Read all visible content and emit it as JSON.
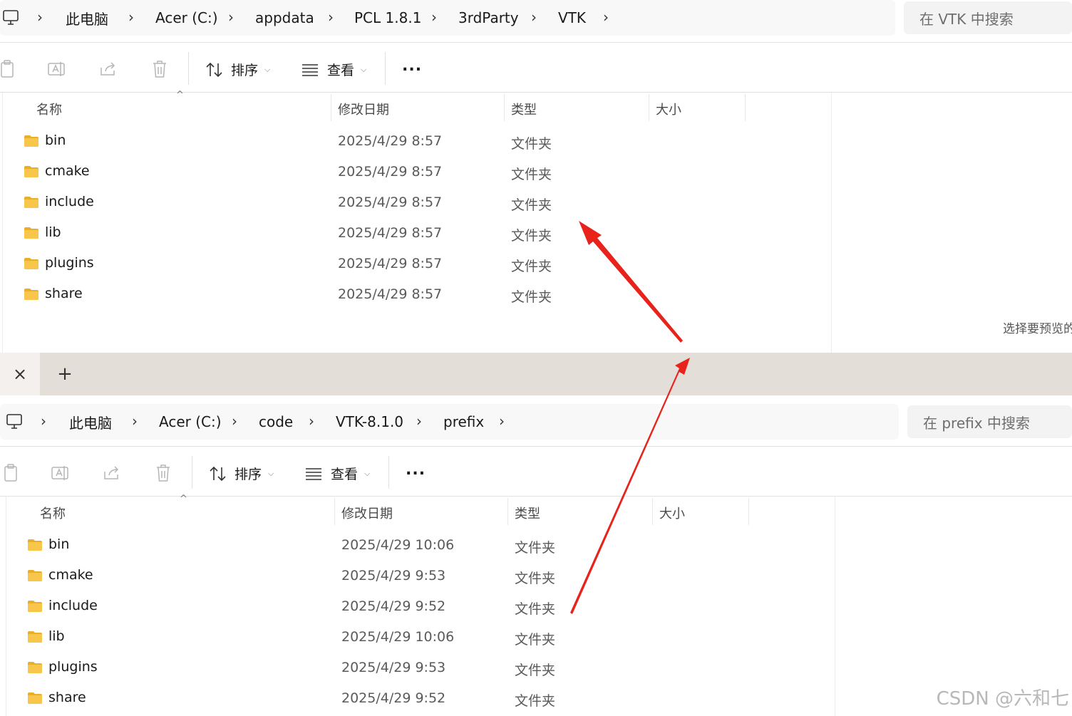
{
  "window1": {
    "breadcrumb": [
      "此电脑",
      "Acer (C:)",
      "appdata",
      "PCL 1.8.1",
      "3rdParty",
      "VTK"
    ],
    "search_placeholder": "在 VTK 中搜索",
    "toolbar": {
      "sort_label": "排序",
      "view_label": "查看",
      "more_label": "..."
    },
    "columns": {
      "name": "名称",
      "date": "修改日期",
      "type": "类型",
      "size": "大小"
    },
    "rows": [
      {
        "name": "bin",
        "date": "2025/4/29 8:57",
        "type": "文件夹"
      },
      {
        "name": "cmake",
        "date": "2025/4/29 8:57",
        "type": "文件夹"
      },
      {
        "name": "include",
        "date": "2025/4/29 8:57",
        "type": "文件夹"
      },
      {
        "name": "lib",
        "date": "2025/4/29 8:57",
        "type": "文件夹"
      },
      {
        "name": "plugins",
        "date": "2025/4/29 8:57",
        "type": "文件夹"
      },
      {
        "name": "share",
        "date": "2025/4/29 8:57",
        "type": "文件夹"
      }
    ],
    "preview_text": "选择要预览的"
  },
  "window2": {
    "tab_close": "×",
    "tab_add": "+",
    "breadcrumb": [
      "此电脑",
      "Acer (C:)",
      "code",
      "VTK-8.1.0",
      "prefix"
    ],
    "search_placeholder": "在 prefix 中搜索",
    "toolbar": {
      "sort_label": "排序",
      "view_label": "查看",
      "more_label": "..."
    },
    "columns": {
      "name": "名称",
      "date": "修改日期",
      "type": "类型",
      "size": "大小"
    },
    "rows": [
      {
        "name": "bin",
        "date": "2025/4/29 10:06",
        "type": "文件夹"
      },
      {
        "name": "cmake",
        "date": "2025/4/29 9:53",
        "type": "文件夹"
      },
      {
        "name": "include",
        "date": "2025/4/29 9:52",
        "type": "文件夹"
      },
      {
        "name": "lib",
        "date": "2025/4/29 10:06",
        "type": "文件夹"
      },
      {
        "name": "plugins",
        "date": "2025/4/29 9:53",
        "type": "文件夹"
      },
      {
        "name": "share",
        "date": "2025/4/29 9:52",
        "type": "文件夹"
      }
    ]
  },
  "watermark": "CSDN @六和七",
  "colors": {
    "folder": "#f7c64a",
    "folder_dark": "#e9ae2a",
    "arrow": "#e8231c",
    "tab_bar": "#e4ded9"
  }
}
